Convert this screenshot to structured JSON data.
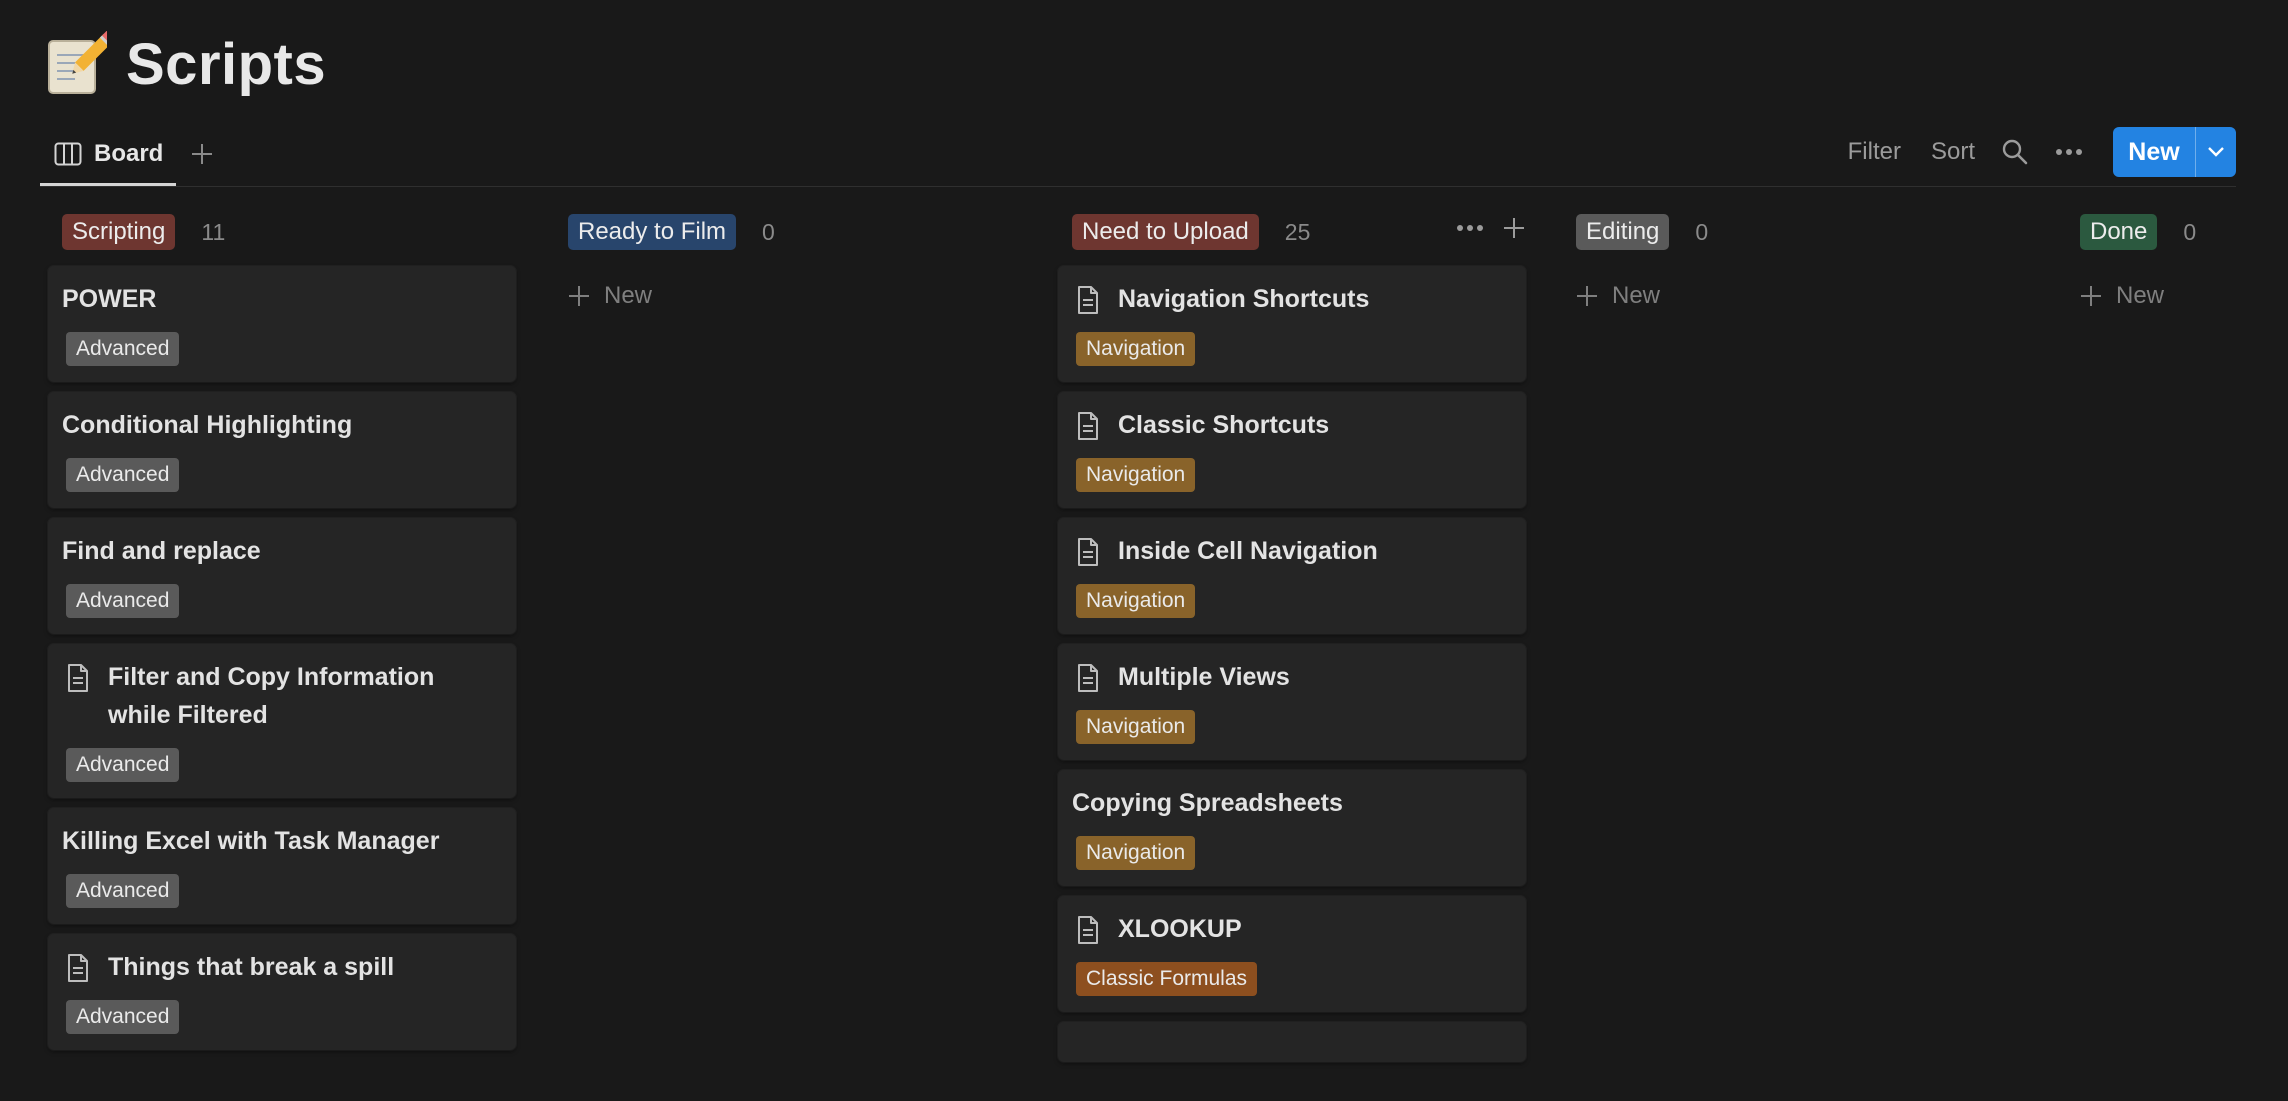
{
  "page": {
    "title": "Scripts",
    "emoji_icon": "memo-pencil-icon"
  },
  "toolbar": {
    "view_tab_label": "Board",
    "filter_label": "Filter",
    "sort_label": "Sort",
    "new_label": "New"
  },
  "columns": [
    {
      "status": "Scripting",
      "count": "11",
      "color": "#6e3630",
      "cards": [
        {
          "title": "POWER",
          "tag": "Advanced",
          "has_doc_icon": false
        },
        {
          "title": "Conditional Highlighting",
          "tag": "Advanced",
          "has_doc_icon": false
        },
        {
          "title": "Find and replace",
          "tag": "Advanced",
          "has_doc_icon": false
        },
        {
          "title": "Filter and Copy Information while Filtered",
          "tag": "Advanced",
          "has_doc_icon": true
        },
        {
          "title": "Killing Excel with Task Manager",
          "tag": "Advanced",
          "has_doc_icon": false
        },
        {
          "title": "Things that break a spill",
          "tag": "Advanced",
          "has_doc_icon": true
        }
      ]
    },
    {
      "status": "Ready to Film",
      "count": "0",
      "color": "#28456c",
      "new_label": "New",
      "cards": []
    },
    {
      "status": "Need to Upload",
      "count": "25",
      "color": "#6e3630",
      "cards": [
        {
          "title": "Navigation Shortcuts",
          "tag": "Navigation",
          "has_doc_icon": true
        },
        {
          "title": "Classic Shortcuts",
          "tag": "Navigation",
          "has_doc_icon": true
        },
        {
          "title": "Inside Cell Navigation",
          "tag": "Navigation",
          "has_doc_icon": true
        },
        {
          "title": "Multiple Views",
          "tag": "Navigation",
          "has_doc_icon": true
        },
        {
          "title": "Copying Spreadsheets",
          "tag": "Navigation",
          "has_doc_icon": false
        },
        {
          "title": "XLOOKUP",
          "tag": "Classic Formulas",
          "has_doc_icon": true
        }
      ]
    },
    {
      "status": "Editing",
      "count": "0",
      "color": "#5a5a5a",
      "new_label": "New",
      "cards": []
    },
    {
      "status": "Done",
      "count": "0",
      "color": "#2b593f",
      "new_label": "New",
      "cards": []
    }
  ],
  "tag_colors": {
    "Advanced": "#5a5a5a",
    "Navigation": "#89632a",
    "Classic Formulas": "#8d4f1f"
  }
}
